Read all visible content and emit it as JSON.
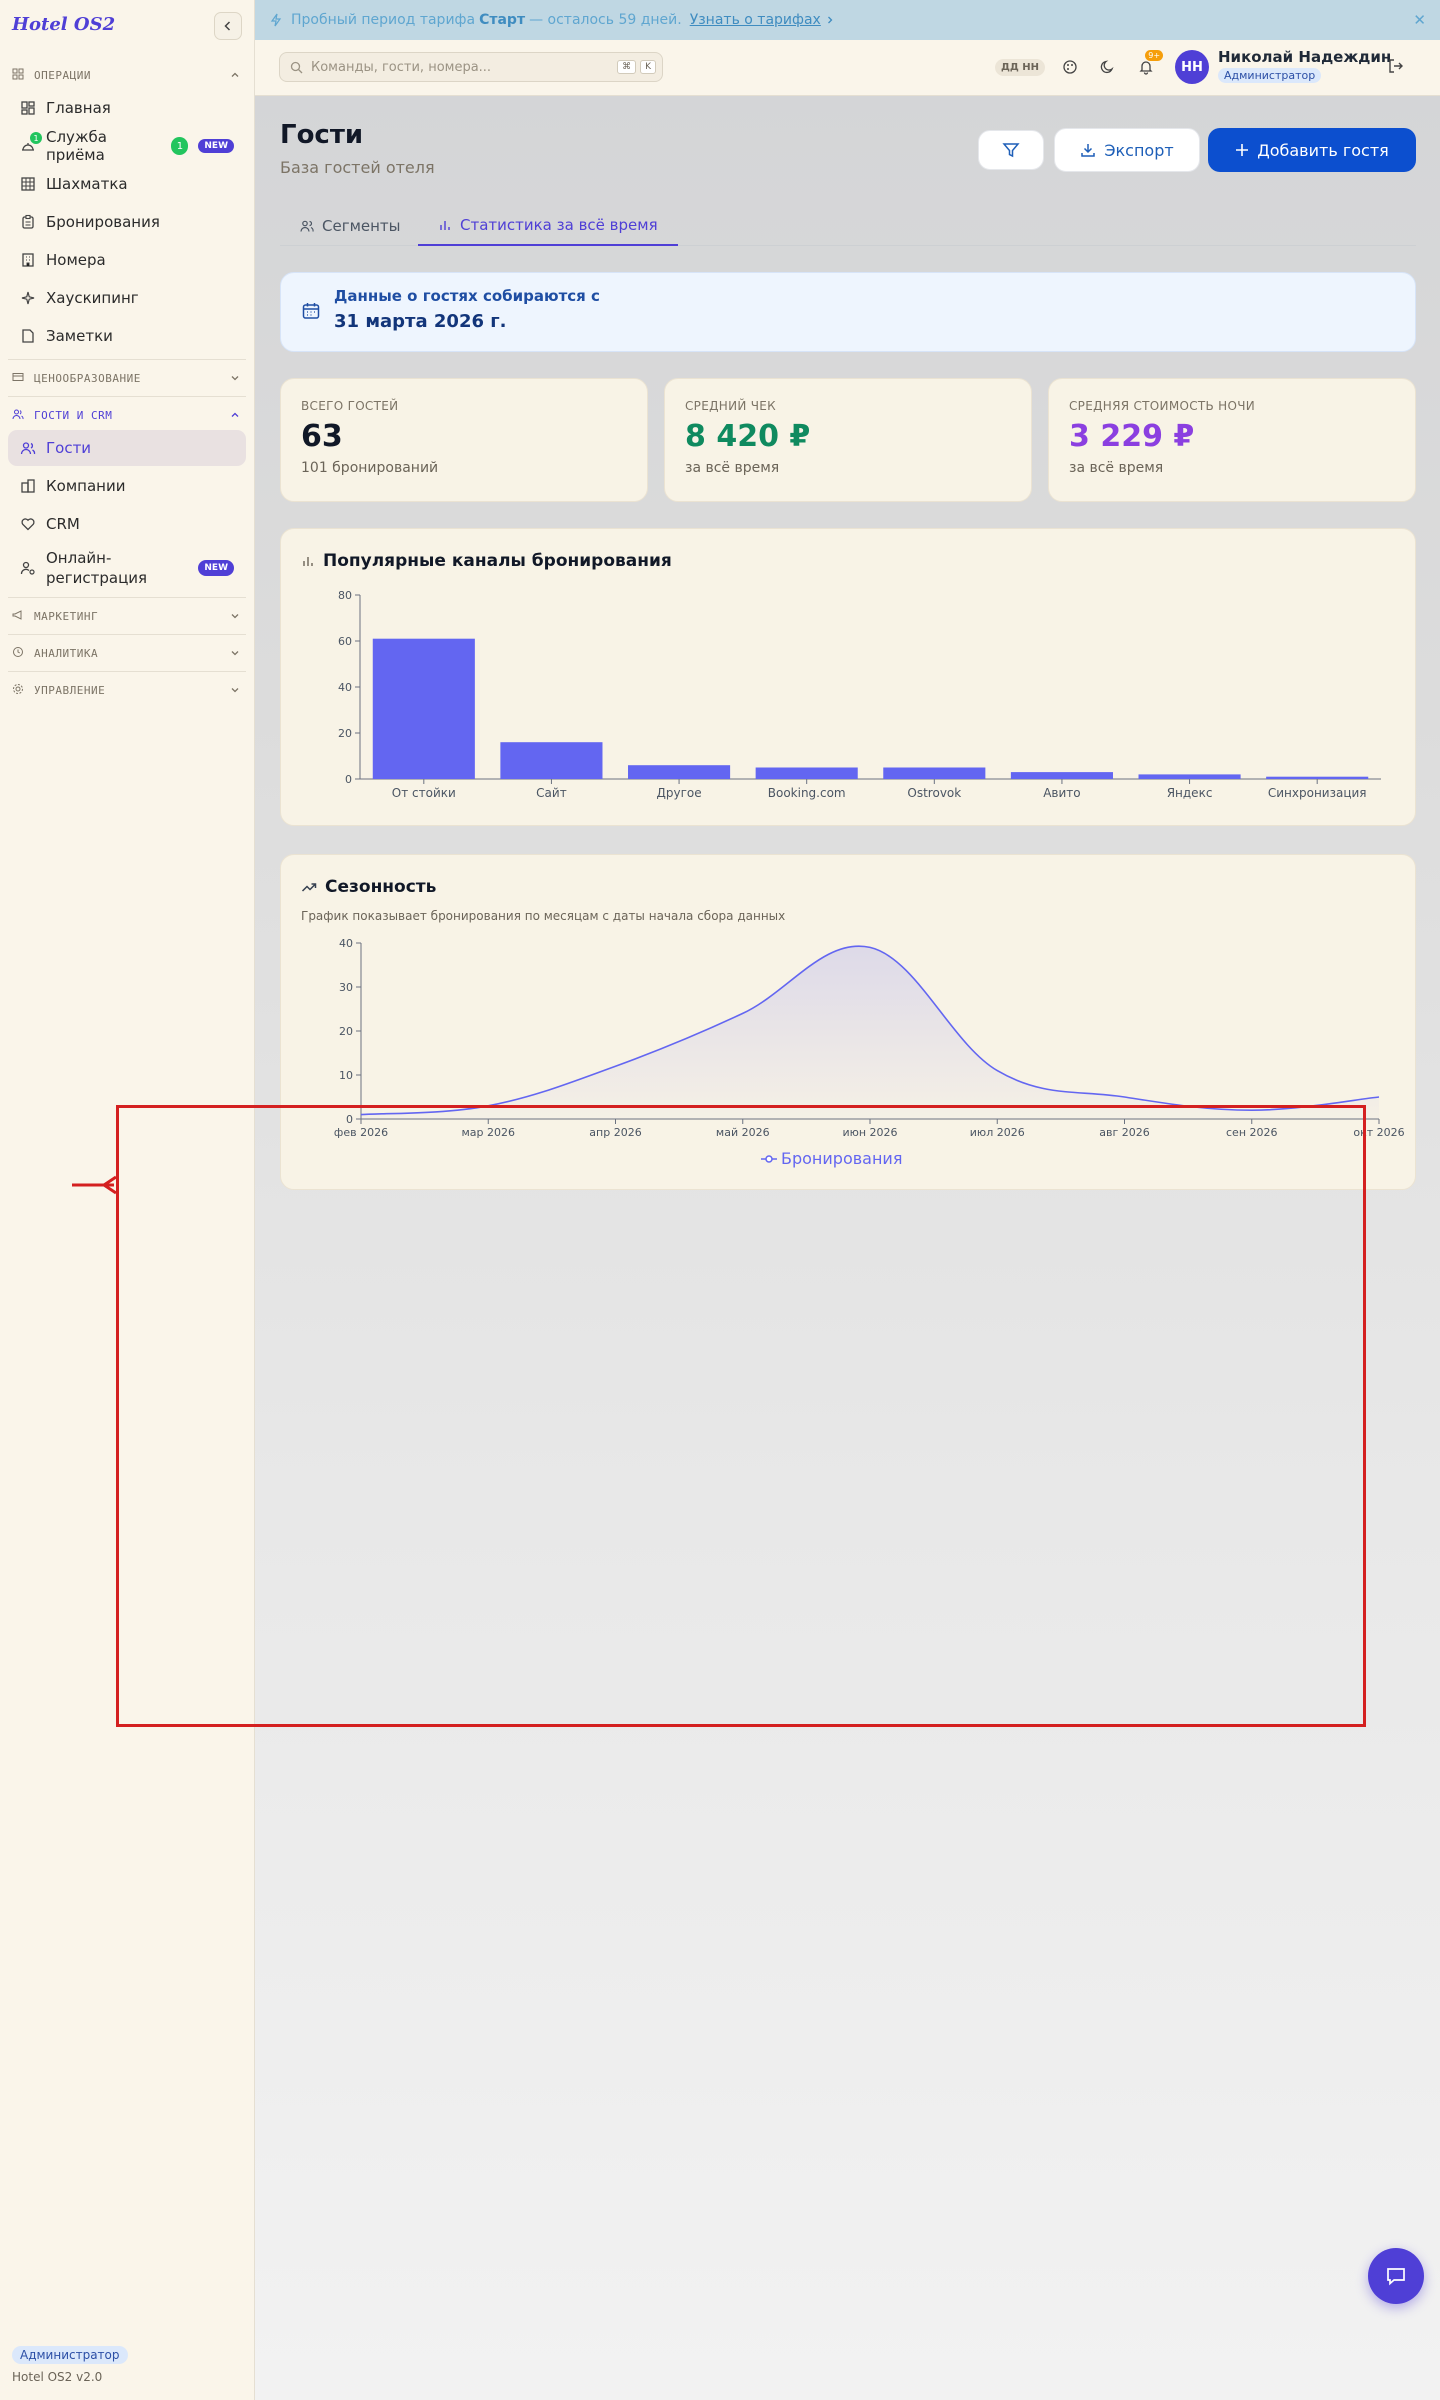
{
  "brand": "Hotel OS2",
  "trial": {
    "prefix": "Пробный период тарифа",
    "plan": "Старт",
    "suffix": "— осталось 59 дней.",
    "link": "Узнать о тарифах"
  },
  "search": {
    "placeholder": "Команды, гости, номера...",
    "kbd1": "⌘",
    "kbd2": "K"
  },
  "header": {
    "initials_pill": "ДД НН",
    "notif_count": "9+",
    "avatar": "НН",
    "user_name": "Николай Надеждин",
    "user_role": "Администратор"
  },
  "sidebar": {
    "sections": {
      "ops": "ОПЕРАЦИИ",
      "pricing": "ЦЕНООБРАЗОВАНИЕ",
      "crm": "ГОСТИ И CRM",
      "marketing": "МАРКЕТИНГ",
      "analytics": "АНАЛИТИКА",
      "management": "УПРАВЛЕНИЕ"
    },
    "items": {
      "home": "Главная",
      "reception": "Служба приёма",
      "reception_count": "1",
      "reception_mini": "1",
      "new_badge": "NEW",
      "chess": "Шахматка",
      "bookings": "Бронирования",
      "rooms": "Номера",
      "housekeeping": "Хаускипинг",
      "notes": "Заметки",
      "guests": "Гости",
      "companies": "Компании",
      "crm": "CRM",
      "online_reg": "Онлайн-регистрация",
      "new_badge2": "NEW"
    },
    "footer_role": "Администратор",
    "version": "Hotel OS2 v2.0"
  },
  "page": {
    "title": "Гости",
    "subtitle": "База гостей отеля",
    "export_label": "Экспорт",
    "add_label": "Добавить гостя",
    "tabs": [
      "Сегменты",
      "Статистика за всё время"
    ]
  },
  "info": {
    "line1": "Данные о гостях собираются с",
    "line2": "31 марта 2026 г."
  },
  "stats": [
    {
      "label": "ВСЕГО ГОСТЕЙ",
      "value": "63",
      "sub": "101 бронирований",
      "color": "#111827"
    },
    {
      "label": "СРЕДНИЙ ЧЕК",
      "value": "8 420 ₽",
      "sub": "за всё время",
      "color": "#0f8a5f"
    },
    {
      "label": "СРЕДНЯЯ СТОИМОСТЬ НОЧИ",
      "value": "3 229 ₽",
      "sub": "за всё время",
      "color": "#8b3fe0"
    }
  ],
  "channels_card": {
    "title": "Популярные каналы бронирования"
  },
  "seasonality_card": {
    "title": "Сезонность",
    "subtitle": "График показывает бронирования по месяцам с даты начала сбора данных"
  },
  "chart_data": [
    {
      "type": "bar",
      "title": "Популярные каналы бронирования",
      "categories": [
        "От стойки",
        "Сайт",
        "Другое",
        "Booking.com",
        "Ostrovok",
        "Авито",
        "Яндекс",
        "Синхронизация"
      ],
      "values": [
        61,
        16,
        6,
        5,
        5,
        3,
        2,
        1
      ],
      "ylim": [
        0,
        80
      ],
      "yticks": [
        0,
        20,
        40,
        60,
        80
      ],
      "color": "#6366f1",
      "grid": false
    },
    {
      "type": "area",
      "title": "Сезонность",
      "categories": [
        "фев 2026",
        "мар 2026",
        "апр 2026",
        "май 2026",
        "июн 2026",
        "июл 2026",
        "авг 2026",
        "сен 2026",
        "окт 2026"
      ],
      "series": [
        {
          "name": "Бронирования",
          "values": [
            1,
            3,
            12,
            24,
            39,
            11,
            5,
            2,
            5
          ]
        }
      ],
      "ylim": [
        0,
        40
      ],
      "yticks": [
        0,
        10,
        20,
        30,
        40
      ],
      "color": "#6366f1",
      "legend": "bottom-center",
      "grid": false
    }
  ]
}
